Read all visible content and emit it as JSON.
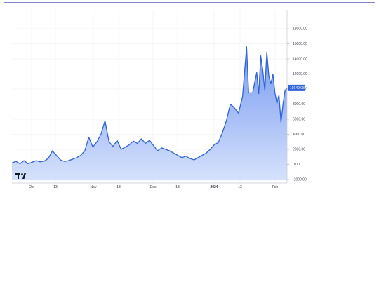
{
  "chart_data": {
    "type": "area",
    "title": "",
    "xlabel": "",
    "ylabel": "",
    "x_tick_labels": [
      "Oct",
      "13",
      "Nov",
      "13",
      "Dec",
      "13",
      "2024",
      "13",
      "Feb"
    ],
    "y_tick_labels": [
      "18000.00",
      "16000.00",
      "14000.00",
      "12000.00",
      "10000.00",
      "8000.00",
      "6000.00",
      "4000.00",
      "2000.00",
      "0.00",
      "-2000.00"
    ],
    "ylim": [
      -2000,
      18000
    ],
    "grid": true,
    "last_value_label": "10149.08",
    "last_value": 10149.08,
    "colors": {
      "line": "#2f63d6",
      "fill_top": "#6f93ef",
      "fill_bottom": "#d3e0fc",
      "label_bg": "#2f63d6"
    },
    "logo_icon": "tradingview-logo-icon",
    "series": [
      {
        "x": [
          "2023-09-24",
          "2023-09-26",
          "2023-09-28",
          "2023-09-30",
          "2023-10-02",
          "2023-10-04",
          "2023-10-06",
          "2023-10-08",
          "2023-10-10",
          "2023-10-12",
          "2023-10-14",
          "2023-10-16",
          "2023-10-18",
          "2023-10-20",
          "2023-10-22",
          "2023-10-24",
          "2023-10-26",
          "2023-10-28",
          "2023-10-30",
          "2023-11-01",
          "2023-11-03",
          "2023-11-05",
          "2023-11-07",
          "2023-11-09",
          "2023-11-11",
          "2023-11-13",
          "2023-11-15",
          "2023-11-17",
          "2023-11-19",
          "2023-11-21",
          "2023-11-23",
          "2023-11-25",
          "2023-11-27",
          "2023-11-29",
          "2023-12-01",
          "2023-12-03",
          "2023-12-05",
          "2023-12-07",
          "2023-12-09",
          "2023-12-11",
          "2023-12-13",
          "2023-12-15",
          "2023-12-17",
          "2023-12-19",
          "2023-12-21",
          "2023-12-23",
          "2023-12-25",
          "2023-12-27",
          "2023-12-29",
          "2023-12-31",
          "2024-01-02",
          "2024-01-04",
          "2024-01-06",
          "2024-01-08",
          "2024-01-10",
          "2024-01-12",
          "2024-01-14",
          "2024-01-16",
          "2024-01-18",
          "2024-01-19",
          "2024-01-21",
          "2024-01-23",
          "2024-01-24",
          "2024-01-25",
          "2024-01-26",
          "2024-01-27",
          "2024-01-28",
          "2024-01-29",
          "2024-01-30",
          "2024-01-31",
          "2024-02-01",
          "2024-02-02",
          "2024-02-03",
          "2024-02-04",
          "2024-02-05",
          "2024-02-06",
          "2024-02-07"
        ],
        "values": [
          200,
          400,
          100,
          500,
          100,
          300,
          500,
          350,
          450,
          800,
          1800,
          1200,
          600,
          400,
          500,
          700,
          900,
          1200,
          1800,
          3600,
          2300,
          3000,
          4000,
          5800,
          3000,
          2400,
          3200,
          2000,
          2300,
          2600,
          3100,
          2800,
          3400,
          2800,
          3200,
          2500,
          1800,
          2200,
          2000,
          1800,
          1500,
          1200,
          900,
          1100,
          800,
          600,
          900,
          1200,
          1500,
          2000,
          2600,
          2900,
          4200,
          5800,
          8000,
          7500,
          6800,
          9000,
          15600,
          9500,
          9500,
          12200,
          9400,
          14400,
          12500,
          9800,
          14900,
          11700,
          10700,
          12000,
          9500,
          8100,
          9200,
          5600,
          8000,
          9800,
          10149
        ]
      }
    ]
  }
}
